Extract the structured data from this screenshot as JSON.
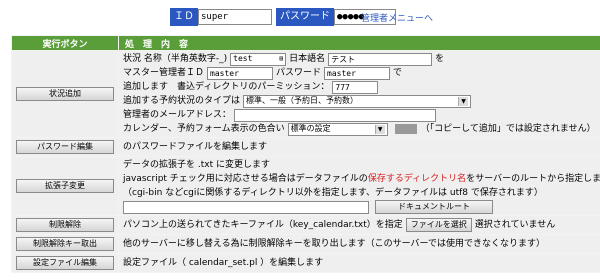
{
  "login": {
    "id_label": "ＩＤ",
    "id_value": "super",
    "pw_label": "パスワード",
    "pw_value": "●●●●●",
    "menu_link": "管理者メニューへ"
  },
  "table": {
    "header_action": "実行ボタン",
    "header_content": "処　理　内　容"
  },
  "rows": {
    "add": {
      "button": "状況追加",
      "name_label": "状況 名称（半角英数字-_)",
      "name_value": "test",
      "jp_name_label": "日本語名",
      "jp_name_value": "テスト",
      "suffix_wo": "を",
      "master_id_label": "マスター管理者ＩＤ",
      "master_id_value": "master",
      "pw_label": "パスワード",
      "pw_value": "master",
      "suffix_de": "で",
      "perm_text": "追加します　書込ディレクトリのパーミッション：",
      "perm_value": "777",
      "type_label": "追加する予約状況のタイプは",
      "type_value": "標準、一般（予約日、予約数）",
      "email_label": "管理者のメールアドレス：",
      "email_value": "",
      "color_label": "カレンダー、予約フォーム表示の色合い",
      "color_value": "標準の設定",
      "color_note": "（「コピーして追加」では設定されません）"
    },
    "password": {
      "button": "パスワード編集",
      "text": "のパスワードファイルを編集します"
    },
    "ext": {
      "button": "拡張子変更",
      "line1": "データの拡張子を .txt に変更します",
      "line2_a": "javascript チェック用に対応させる場合はデータファイルの",
      "line2_red": "保存するディレクトリ名",
      "line2_b": "をサーバーのルートから指定します",
      "line3": "（cgi-bin などcgiに関係するディレクトリ以外を指定します、データファイルは utf8 で保存されます）",
      "path_value": "",
      "doc_root_button": "ドキュメントルート"
    },
    "unlock": {
      "button": "制限解除",
      "text": "パソコン上の送られてきたキーファイル（key_calendar.txt）を指定",
      "file_button": "ファイルを選択",
      "file_status": "選択されていません"
    },
    "unlock_key": {
      "button": "制限解除キー取出",
      "text": "他のサーバーに移し替える為に制限解除キーを取り出します（このサーバーでは使用できなくなります）"
    },
    "settings": {
      "button": "設定ファイル編集",
      "text": "設定ファイル（ calendar_set.pl ）を編集します"
    }
  },
  "colors": {
    "header_bg": "#5a9e3a",
    "tag_bg": "#2a57c0",
    "link": "#2a57c0",
    "warning_red": "#d42222"
  }
}
